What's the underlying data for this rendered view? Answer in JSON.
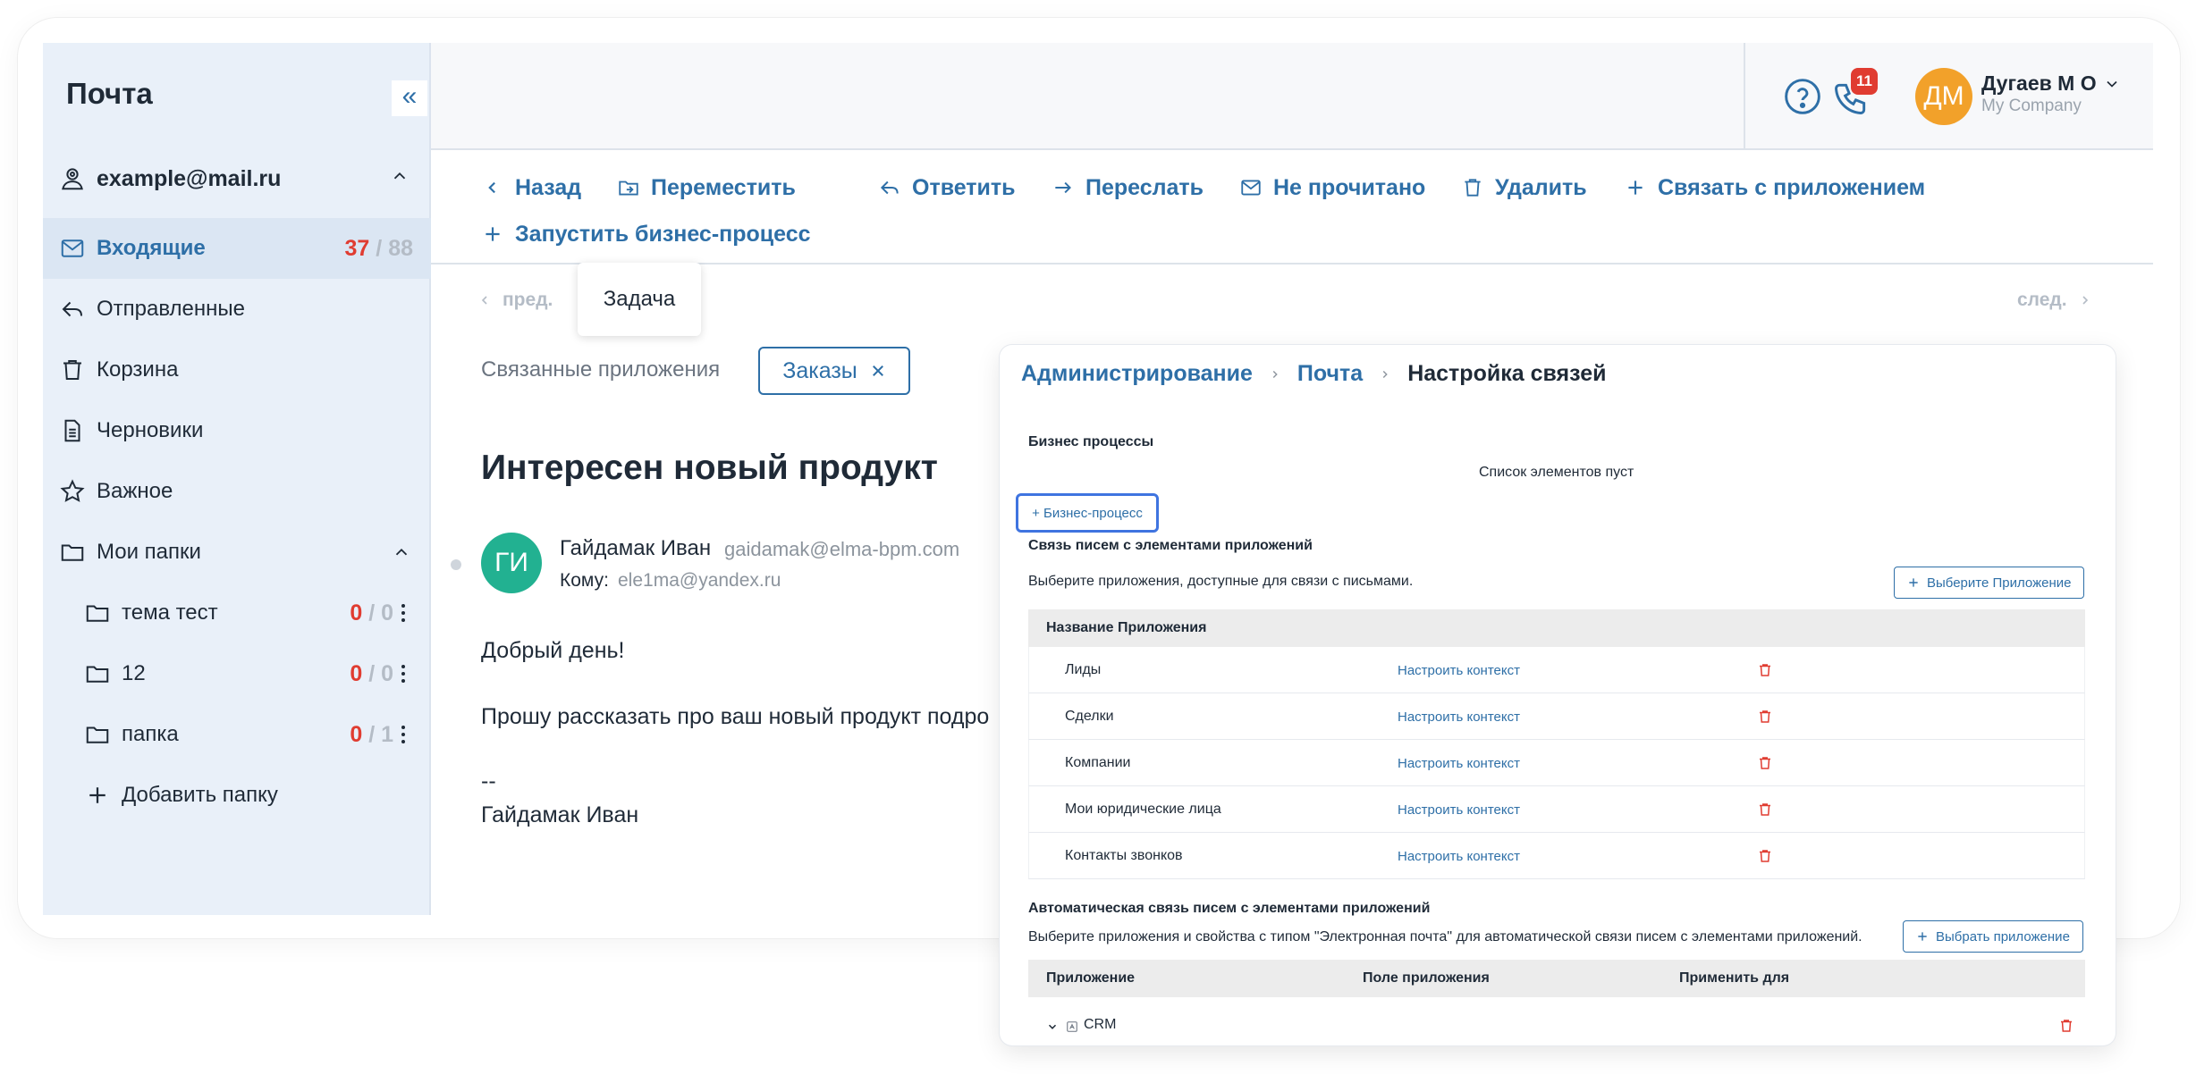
{
  "sidebar": {
    "title": "Почта",
    "collapse_label": "«",
    "account": "example@mail.ru",
    "items": [
      {
        "label": "Входящие",
        "unread": "37",
        "sep": " / ",
        "total": "88"
      },
      {
        "label": "Отправленные"
      },
      {
        "label": "Корзина"
      },
      {
        "label": "Черновики"
      },
      {
        "label": "Важное"
      },
      {
        "label": "Мои папки"
      }
    ],
    "folders": [
      {
        "label": "тема тест",
        "unread": "0",
        "sep": " / ",
        "total": "0"
      },
      {
        "label": "12",
        "unread": "0",
        "sep": " / ",
        "total": "0"
      },
      {
        "label": "папка",
        "unread": "0",
        "sep": " / ",
        "total": "1"
      }
    ],
    "add_folder": "Добавить папку"
  },
  "topbar": {
    "badge": "11",
    "avatar_initials": "ДМ",
    "user_name": "Дугаев М О",
    "user_company": "My Company"
  },
  "toolbar": {
    "back": "Назад",
    "move": "Переместить",
    "reply": "Ответить",
    "forward": "Переслать",
    "unread": "Не прочитано",
    "delete": "Удалить",
    "link_app": "Связать с приложением",
    "start_bp": "Запустить бизнес-процесс"
  },
  "pager": {
    "prev": "пред.",
    "next": "след."
  },
  "tooltip": "Задача",
  "mail": {
    "linked_label": "Связанные приложения",
    "chip": "Заказы",
    "subject": "Интересен новый продукт",
    "sender_initials": "ГИ",
    "sender_name": "Гайдамак Иван",
    "sender_email": "gaidamak@elma-bpm.com",
    "to_label": "Кому:",
    "to_email": "ele1ma@yandex.ru",
    "body": [
      "Добрый день!",
      "Прошу рассказать про ваш новый продукт подро",
      "--",
      "Гайдамак Иван"
    ]
  },
  "panel": {
    "breadcrumbs": [
      "Администрирование",
      "Почта",
      "Настройка связей"
    ],
    "bp_heading": "Бизнес процессы",
    "empty_list": "Список элементов пуст",
    "bp_button": "+ Бизнес-процесс",
    "link_heading": "Связь писем с элементами приложений",
    "link_desc": "Выберите приложения, доступные для связи с письмами.",
    "choose_app_button": "Выберите Приложение",
    "table_header": "Название Приложения",
    "configure_label": "Настроить контекст",
    "rows": [
      {
        "name": "Лиды"
      },
      {
        "name": "Сделки"
      },
      {
        "name": "Компании"
      },
      {
        "name": "Мои юридические лица"
      },
      {
        "name": "Контакты звонков"
      }
    ],
    "auto_heading": "Автоматическая связь писем с элементами приложений",
    "auto_desc": "Выберите приложения и свойства с типом \"Электронная почта\" для автоматической связи писем с элементами приложений.",
    "choose_app_button2": "Выбрать приложение",
    "auto_columns": [
      "Приложение",
      "Поле приложения",
      "Применить для"
    ],
    "auto_row": "CRM"
  },
  "colors": {
    "accent": "#2e6fa7",
    "danger": "#e03c31",
    "sidebar_bg": "#e9f0f9",
    "avatar_user": "#f2a12a",
    "avatar_sender": "#22b191"
  }
}
